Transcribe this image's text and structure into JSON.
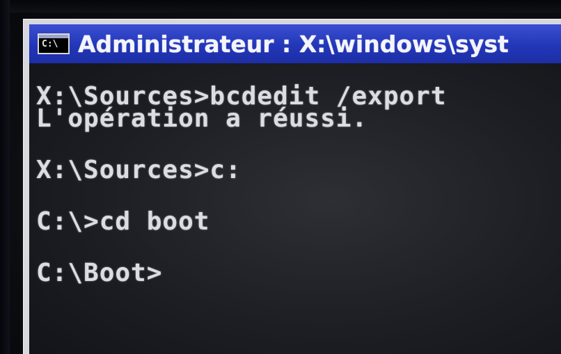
{
  "window": {
    "title": "Administrateur : X:\\windows\\syst",
    "icon_label": "C:\\",
    "icon_name": "cmd-console-icon"
  },
  "console": {
    "lines": [
      "X:\\Sources>bcdedit /export",
      "L'opération a réussi.",
      "",
      "X:\\Sources>c:",
      "",
      "C:\\>cd boot",
      "",
      "C:\\Boot>"
    ]
  },
  "colors": {
    "titlebar": "#2236b8",
    "console_bg": "#1c1e23",
    "console_text": "#dcdde3"
  }
}
